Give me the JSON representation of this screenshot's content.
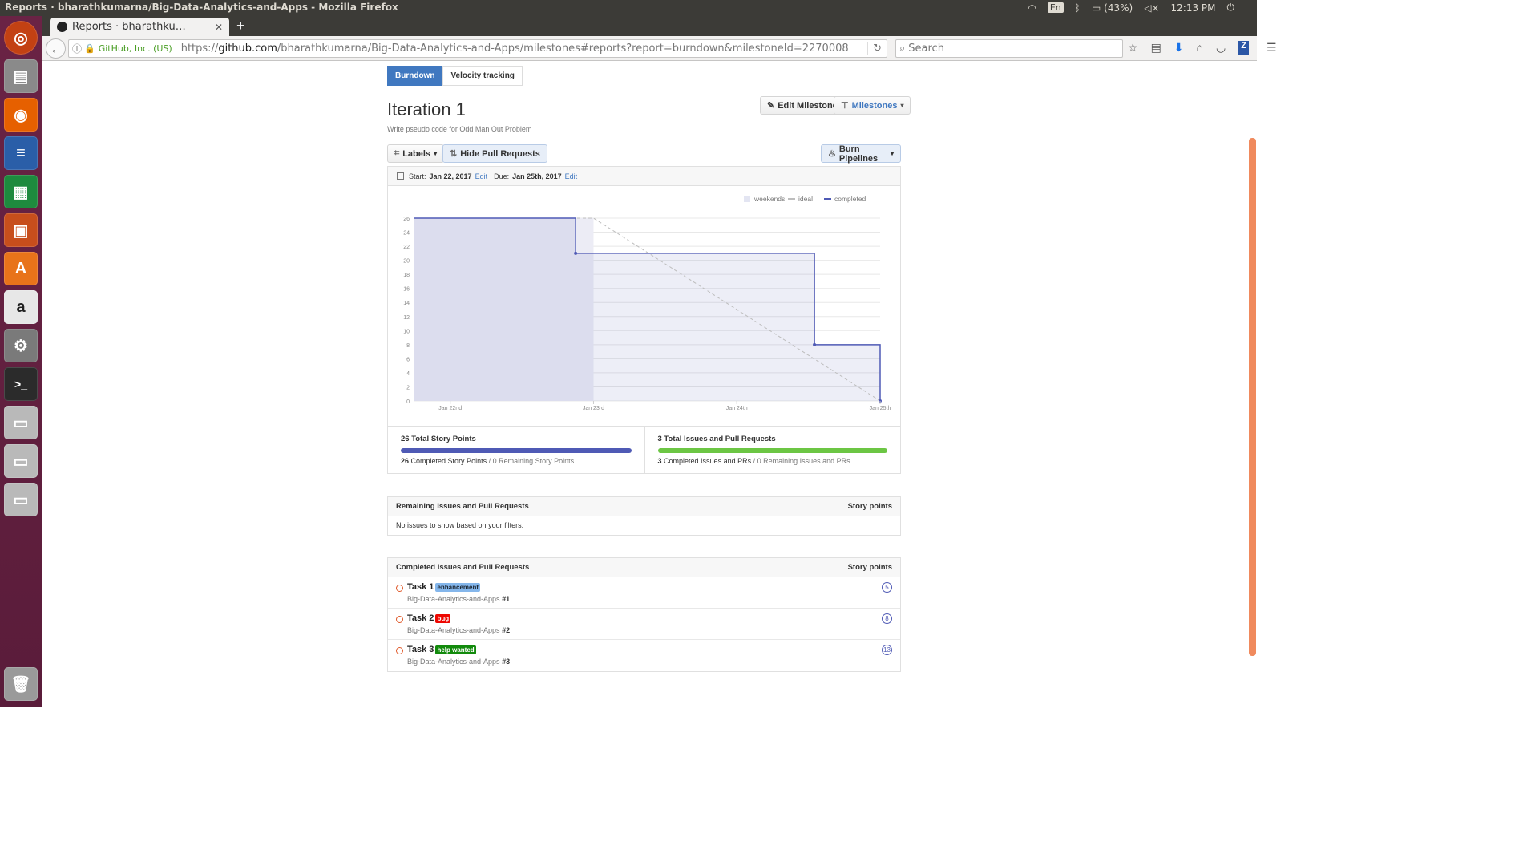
{
  "os": {
    "window_title": "Reports · bharathkumarna/Big-Data-Analytics-and-Apps - Mozilla Firefox",
    "keyboard": "En",
    "battery": "(43%)",
    "clock": "12:13 PM"
  },
  "browser": {
    "tab_title": "Reports · bharathku…",
    "new_tab": "+",
    "identity": "GitHub, Inc. (US)",
    "url_proto": "https://",
    "url_host": "github.com",
    "url_path": "/bharathkumarna/Big-Data-Analytics-and-Apps/milestones#reports?report=burndown&milestoneId=2270008",
    "search_placeholder": "Search"
  },
  "tabs": {
    "burndown": "Burndown",
    "velocity": "Velocity tracking"
  },
  "milestone": {
    "title": "Iteration 1",
    "description": "Write pseudo code for Odd Man Out Problem",
    "edit_label": "Edit Milestone",
    "milestones_label": "Milestones"
  },
  "toolbar": {
    "labels": "Labels",
    "hide_prs": "Hide Pull Requests",
    "burn_pipelines": "Burn Pipelines"
  },
  "dates": {
    "start_label": "Start:",
    "start": "Jan 22, 2017",
    "due_label": "Due:",
    "due": "Jan 25th, 2017",
    "edit": "Edit"
  },
  "chart_data": {
    "type": "line",
    "legend": [
      "weekends",
      "ideal",
      "completed"
    ],
    "legend_position": "top-right",
    "x_ticks": [
      "Jan 22nd",
      "Jan 23rd",
      "Jan 24th",
      "Jan 25th"
    ],
    "y_ticks": [
      0,
      2,
      4,
      6,
      8,
      10,
      12,
      14,
      16,
      18,
      20,
      22,
      24,
      26
    ],
    "ylim": [
      0,
      26
    ],
    "xlim": [
      "Jan 21st 18:00",
      "Jan 25th"
    ],
    "weekend_span": [
      "Jan 21st 18:00",
      "Jan 23rd"
    ],
    "series": [
      {
        "name": "ideal",
        "style": "dashed",
        "color": "#bdbdbd",
        "points": [
          [
            "Jan 21st 18:00",
            26
          ],
          [
            "Jan 23rd",
            26
          ],
          [
            "Jan 25th",
            0
          ]
        ]
      },
      {
        "name": "completed",
        "style": "step",
        "color": "#4f5ab5",
        "points": [
          [
            "Jan 21st 18:00",
            26
          ],
          [
            "Jan 22nd 21:00",
            21
          ],
          [
            "Jan 24th 13:00",
            8
          ],
          [
            "Jan 25th",
            0
          ]
        ]
      }
    ],
    "grid": true
  },
  "summary": {
    "story_points_total": "26 Total Story Points",
    "story_points_completed_num": "26",
    "story_points_completed_text": "Completed Story Points",
    "story_points_remaining": "/ 0 Remaining Story Points",
    "story_points_fraction": 1.0,
    "issues_total": "3 Total Issues and Pull Requests",
    "issues_completed_num": "3",
    "issues_completed_text": "Completed Issues and PRs",
    "issues_remaining": "/ 0 Remaining Issues and PRs",
    "issues_fraction": 1.0,
    "story_color": "#4f5ab5",
    "issues_color": "#6cc644"
  },
  "remaining": {
    "title": "Remaining Issues and Pull Requests",
    "col": "Story points",
    "empty": "No issues to show based on your filters."
  },
  "completed": {
    "title": "Completed Issues and Pull Requests",
    "col": "Story points",
    "issues": [
      {
        "title": "Task 1",
        "label": "enhancement",
        "label_bg": "#84b6eb",
        "label_fg": "#1c2733",
        "repo": "Big-Data-Analytics-and-Apps",
        "num": "#1",
        "points": "5"
      },
      {
        "title": "Task 2",
        "label": "bug",
        "label_bg": "#ee0701",
        "label_fg": "#ffffff",
        "repo": "Big-Data-Analytics-and-Apps",
        "num": "#2",
        "points": "8"
      },
      {
        "title": "Task 3",
        "label": "help wanted",
        "label_bg": "#128a0c",
        "label_fg": "#ffffff",
        "repo": "Big-Data-Analytics-and-Apps",
        "num": "#3",
        "points": "13"
      }
    ]
  }
}
